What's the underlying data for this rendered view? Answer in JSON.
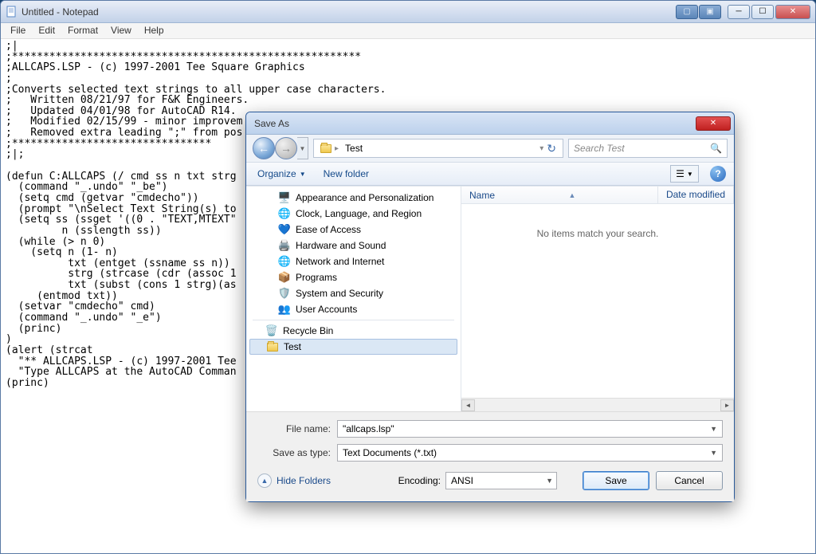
{
  "notepad": {
    "title": "Untitled - Notepad",
    "menus": [
      "File",
      "Edit",
      "Format",
      "View",
      "Help"
    ],
    "content": ";|\n;********************************************************\n;ALLCAPS.LSP - (c) 1997-2001 Tee Square Graphics\n;\n;Converts selected text strings to all upper case characters.\n;   Written 08/21/97 for F&K Engineers.\n;   Updated 04/01/98 for AutoCAD R14.\n;   Modified 02/15/99 - minor improvem\n;   Removed extra leading \";\" from pos\n;********************************\n;|;\n\n(defun C:ALLCAPS (/ cmd ss n txt strg\n  (command \"_.undo\" \"_be\")\n  (setq cmd (getvar \"cmdecho\"))\n  (prompt \"\\nSelect Text String(s) to\n  (setq ss (ssget '((0 . \"TEXT,MTEXT\"\n         n (sslength ss))\n  (while (> n 0)\n    (setq n (1- n)\n          txt (entget (ssname ss n))\n          strg (strcase (cdr (assoc 1\n          txt (subst (cons 1 strg)(as\n     (entmod txt))\n  (setvar \"cmdecho\" cmd)\n  (command \"_.undo\" \"_e\")\n  (princ)\n)\n(alert (strcat\n  \"** ALLCAPS.LSP - (c) 1997-2001 Tee\n  \"Type ALLCAPS at the AutoCAD Comman\n(princ)"
  },
  "saveas": {
    "title": "Save As",
    "breadcrumb_item": "Test",
    "search_placeholder": "Search Test",
    "toolbar": {
      "organize": "Organize",
      "newfolder": "New folder"
    },
    "tree": [
      {
        "label": "Appearance and Personalization",
        "icon": "🖥️"
      },
      {
        "label": "Clock, Language, and Region",
        "icon": "🌐"
      },
      {
        "label": "Ease of Access",
        "icon": "💙"
      },
      {
        "label": "Hardware and Sound",
        "icon": "🖨️"
      },
      {
        "label": "Network and Internet",
        "icon": "🌐"
      },
      {
        "label": "Programs",
        "icon": "📦"
      },
      {
        "label": "System and Security",
        "icon": "🛡️"
      },
      {
        "label": "User Accounts",
        "icon": "👥"
      }
    ],
    "tree2": [
      {
        "label": "Recycle Bin",
        "icon": "🗑️"
      },
      {
        "label": "Test",
        "icon": "folder",
        "selected": true
      }
    ],
    "list_columns": {
      "name": "Name",
      "date": "Date modified"
    },
    "empty_msg": "No items match your search.",
    "filename_label": "File name:",
    "filename_value": "\"allcaps.lsp\"",
    "saveastype_label": "Save as type:",
    "saveastype_value": "Text Documents (*.txt)",
    "hide_folders": "Hide Folders",
    "encoding_label": "Encoding:",
    "encoding_value": "ANSI",
    "save_btn": "Save",
    "cancel_btn": "Cancel"
  }
}
